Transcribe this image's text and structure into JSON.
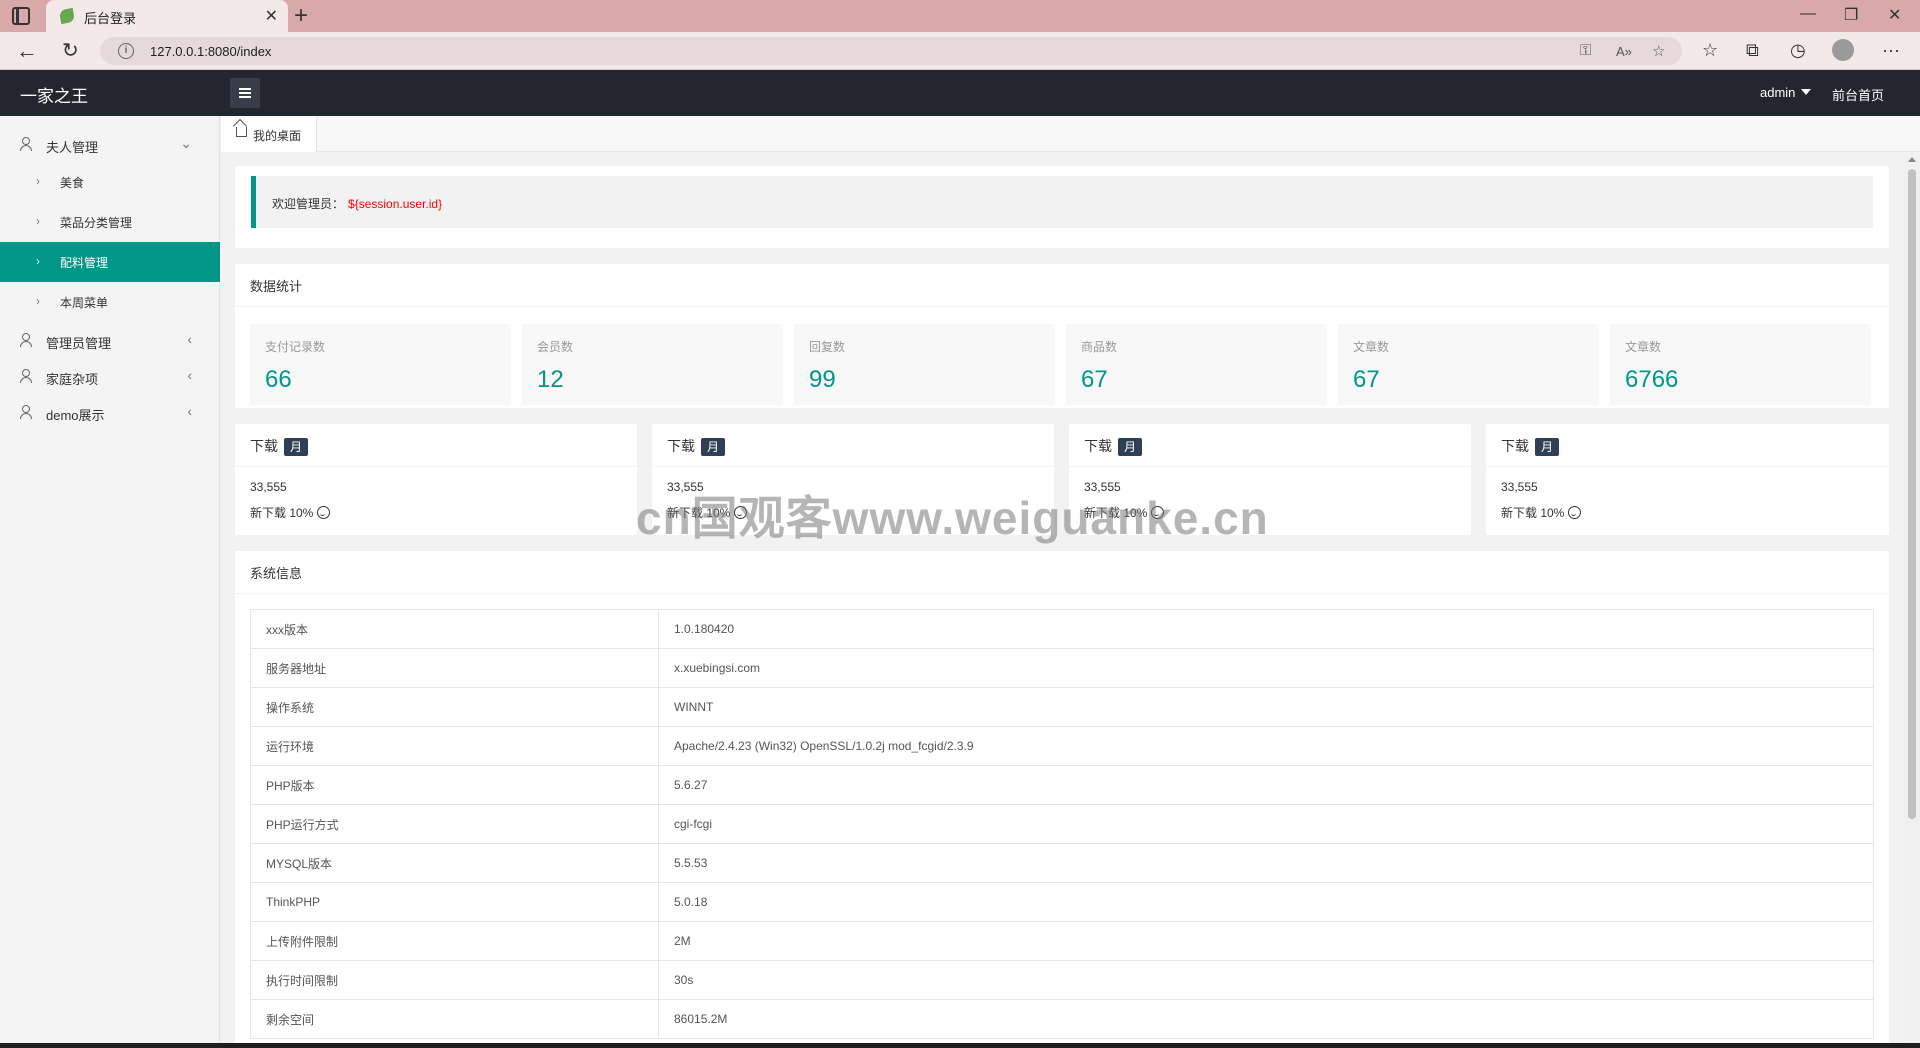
{
  "browser": {
    "tab_title": "后台登录",
    "url": "127.0.0.1:8080/index"
  },
  "header": {
    "brand": "一家之王",
    "user": "admin",
    "front_link": "前台首页"
  },
  "sidebar": {
    "groups": [
      {
        "label": "夫人管理",
        "chevron": "⌄"
      },
      {
        "label": "管理员管理",
        "chevron": "‹"
      },
      {
        "label": "家庭杂项",
        "chevron": "‹"
      },
      {
        "label": "demo展示",
        "chevron": "‹"
      }
    ],
    "sub_items": [
      {
        "label": "美食",
        "arrow": "›"
      },
      {
        "label": "菜品分类管理",
        "arrow": "›"
      },
      {
        "label": "配料管理",
        "arrow": "›",
        "active": true
      },
      {
        "label": "本周菜单",
        "arrow": "›"
      }
    ]
  },
  "tabs": {
    "home": "我的桌面"
  },
  "welcome": {
    "label": "欢迎管理员：",
    "user_expr": "${session.user.id}"
  },
  "stats": {
    "title": "数据统计",
    "items": [
      {
        "label": "支付记录数",
        "value": "66"
      },
      {
        "label": "会员数",
        "value": "12"
      },
      {
        "label": "回复数",
        "value": "99"
      },
      {
        "label": "商品数",
        "value": "67"
      },
      {
        "label": "文章数",
        "value": "67"
      },
      {
        "label": "文章数",
        "value": "6766"
      }
    ]
  },
  "downloads": [
    {
      "title": "下载",
      "badge": "月",
      "number": "33,555",
      "sub": "新下载 10%"
    },
    {
      "title": "下载",
      "badge": "月",
      "number": "33,555",
      "sub": "新下载 10%"
    },
    {
      "title": "下载",
      "badge": "月",
      "number": "33,555",
      "sub": "新下载 10%"
    },
    {
      "title": "下载",
      "badge": "月",
      "number": "33,555",
      "sub": "新下载 10%"
    }
  ],
  "system": {
    "title": "系统信息",
    "rows": [
      {
        "key": "xxx版本",
        "value": "1.0.180420"
      },
      {
        "key": "服务器地址",
        "value": "x.xuebingsi.com"
      },
      {
        "key": "操作系统",
        "value": "WINNT"
      },
      {
        "key": "运行环境",
        "value": "Apache/2.4.23 (Win32) OpenSSL/1.0.2j mod_fcgid/2.3.9"
      },
      {
        "key": "PHP版本",
        "value": "5.6.27"
      },
      {
        "key": "PHP运行方式",
        "value": "cgi-fcgi"
      },
      {
        "key": "MYSQL版本",
        "value": "5.5.53"
      },
      {
        "key": "ThinkPHP",
        "value": "5.0.18"
      },
      {
        "key": "上传附件限制",
        "value": "2M"
      },
      {
        "key": "执行时间限制",
        "value": "30s"
      },
      {
        "key": "剩余空间",
        "value": "86015.2M"
      }
    ]
  },
  "watermark": "cn国观客www.weiguanke.cn",
  "colors": {
    "accent": "#009688",
    "header": "#23262e",
    "badge": "#2f4056"
  }
}
